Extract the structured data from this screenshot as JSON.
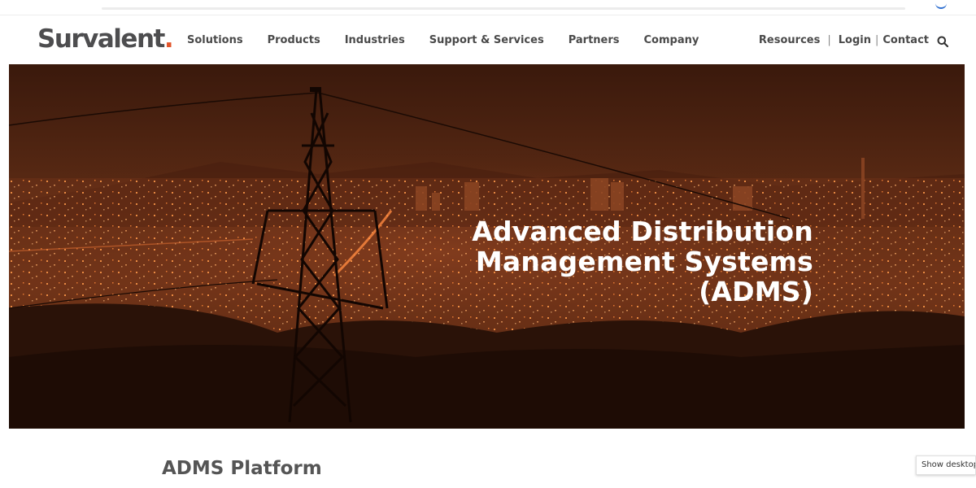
{
  "brand": {
    "name": "Survalent",
    "dot": ".",
    "accent_color": "#e2542a"
  },
  "nav": {
    "items": [
      {
        "label": "Solutions"
      },
      {
        "label": "Products"
      },
      {
        "label": "Industries"
      },
      {
        "label": "Support & Services"
      },
      {
        "label": "Partners"
      },
      {
        "label": "Company"
      }
    ]
  },
  "utility": {
    "resources": "Resources",
    "separator": "|",
    "login": "Login",
    "contact": "Contact",
    "search_icon": "search-icon"
  },
  "hero": {
    "title_line1": "Advanced Distribution",
    "title_line2": "Management Systems",
    "title_line3": "(ADMS)",
    "overlay_color": "#e06a2c"
  },
  "main": {
    "section_title": "ADMS Platform"
  },
  "overlay": {
    "show_desktop_label": "Show desktop"
  }
}
